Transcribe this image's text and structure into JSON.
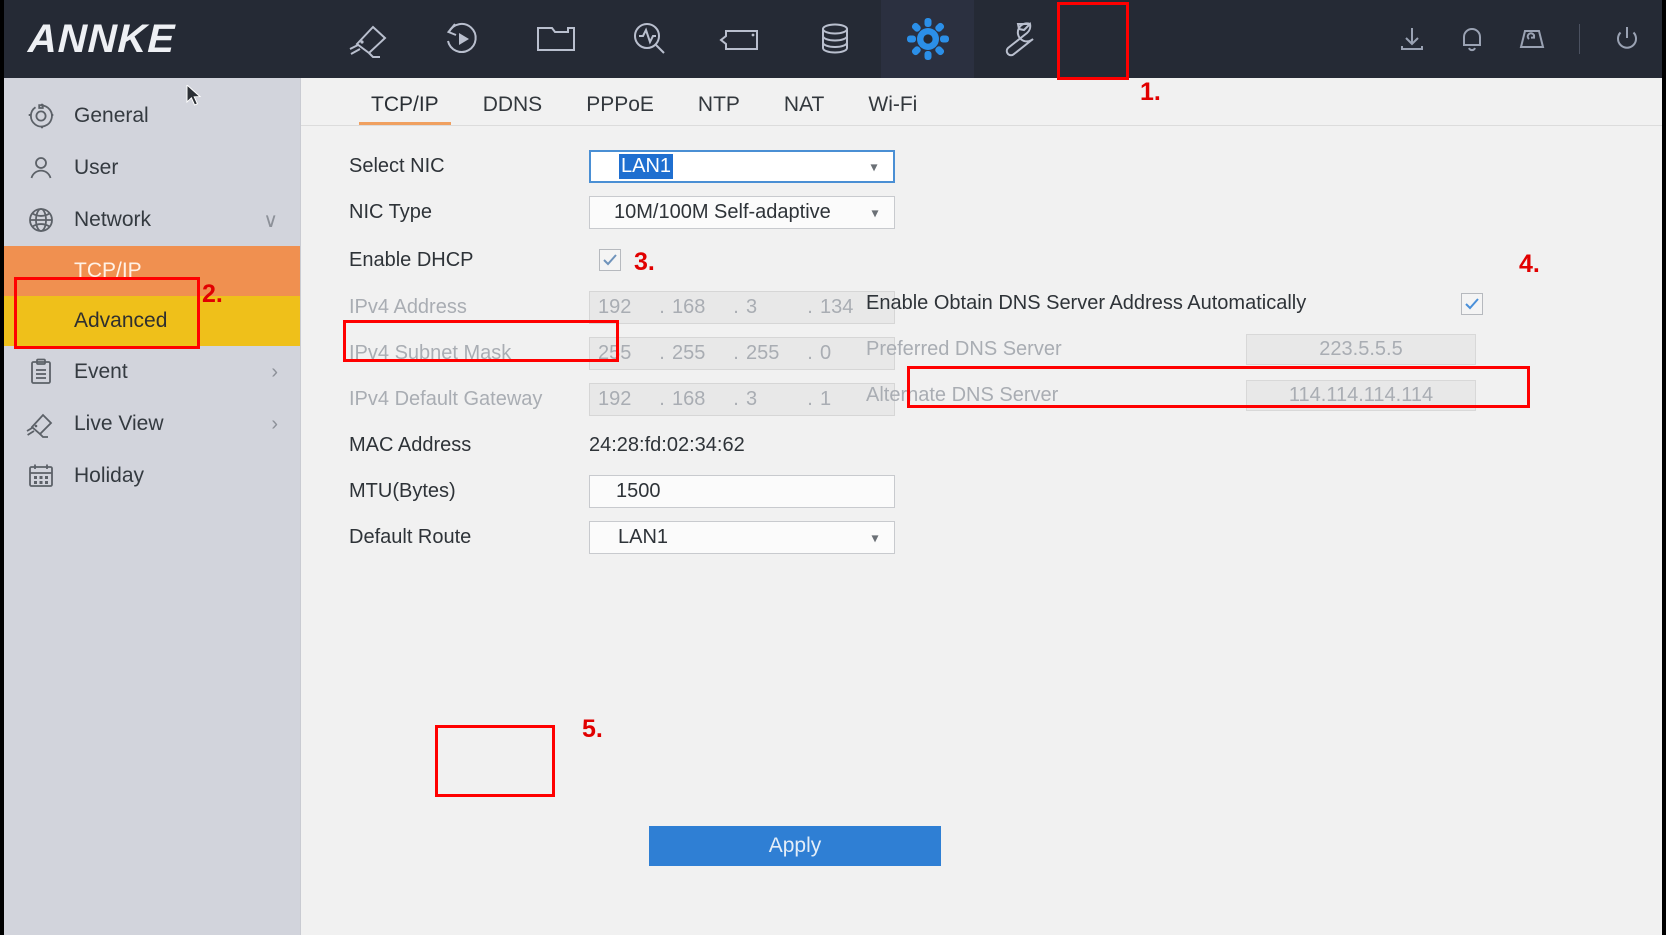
{
  "brand": {
    "name": "ANNKE"
  },
  "topbar": {
    "nav_icons": [
      {
        "name": "camera-icon",
        "label": "Camera"
      },
      {
        "name": "playback-icon",
        "label": "Playback"
      },
      {
        "name": "folder-icon",
        "label": "File Management"
      },
      {
        "name": "smart-search-icon",
        "label": "Smart Analysis"
      },
      {
        "name": "record-icon",
        "label": "Record"
      },
      {
        "name": "storage-icon",
        "label": "Storage"
      },
      {
        "name": "gear-icon",
        "label": "System Configuration"
      },
      {
        "name": "wrench-icon",
        "label": "Maintenance"
      }
    ],
    "active_icon": "gear-icon",
    "right_icons": [
      {
        "name": "download-icon",
        "label": "Download"
      },
      {
        "name": "bell-icon",
        "label": "Alarm"
      },
      {
        "name": "device-icon",
        "label": "Device"
      },
      {
        "name": "power-icon",
        "label": "Power"
      }
    ]
  },
  "sidebar": {
    "items": [
      {
        "label": "General",
        "icon": "gear-outline-icon",
        "expandable": false,
        "chevron": ""
      },
      {
        "label": "User",
        "icon": "user-icon",
        "expandable": false,
        "chevron": ""
      },
      {
        "label": "Network",
        "icon": "globe-icon",
        "expandable": true,
        "chevron": "∨"
      },
      {
        "label": "Event",
        "icon": "clipboard-icon",
        "expandable": true,
        "chevron": "›"
      },
      {
        "label": "Live View",
        "icon": "camera-icon",
        "expandable": true,
        "chevron": "›"
      },
      {
        "label": "Holiday",
        "icon": "calendar-icon",
        "expandable": false,
        "chevron": ""
      }
    ],
    "network_children": [
      {
        "label": "TCP/IP",
        "state": "selected"
      },
      {
        "label": "Advanced",
        "state": "hover"
      }
    ]
  },
  "tabs": {
    "items": [
      "TCP/IP",
      "DDNS",
      "PPPoE",
      "NTP",
      "NAT",
      "Wi-Fi"
    ],
    "active": "TCP/IP"
  },
  "form": {
    "select_nic": {
      "label": "Select NIC",
      "value": "LAN1",
      "selected_text": true
    },
    "nic_type": {
      "label": "NIC Type",
      "value": "10M/100M Self-adaptive"
    },
    "enable_dhcp": {
      "label": "Enable DHCP",
      "checked": true
    },
    "ipv4_address": {
      "label": "IPv4 Address",
      "octets": [
        "192",
        "168",
        "3",
        "134"
      ],
      "disabled": true
    },
    "ipv4_subnet_mask": {
      "label": "IPv4 Subnet Mask",
      "octets": [
        "255",
        "255",
        "255",
        "0"
      ],
      "disabled": true
    },
    "ipv4_default_gateway": {
      "label": "IPv4 Default Gateway",
      "octets": [
        "192",
        "168",
        "3",
        "1"
      ],
      "disabled": true
    },
    "mac_address": {
      "label": "MAC Address",
      "value": "24:28:fd:02:34:62"
    },
    "mtu": {
      "label": "MTU(Bytes)",
      "value": "1500"
    },
    "default_route": {
      "label": "Default Route",
      "value": "LAN1"
    },
    "dns_auto": {
      "label": "Enable Obtain DNS Server Address Automatically",
      "checked": true
    },
    "preferred_dns": {
      "label": "Preferred DNS Server",
      "value": "223.5.5.5",
      "disabled": true
    },
    "alternate_dns": {
      "label": "Alternate DNS Server",
      "value": "114.114.114.114",
      "disabled": true
    },
    "apply_button": {
      "label": "Apply"
    }
  },
  "annotations": {
    "color": "#ff0000",
    "steps": [
      {
        "number": "1.",
        "target": "gear-icon"
      },
      {
        "number": "2.",
        "target": "network-tcpip-sidebar"
      },
      {
        "number": "3.",
        "target": "enable-dhcp-row"
      },
      {
        "number": "4.",
        "target": "dns-auto-row"
      },
      {
        "number": "5.",
        "target": "apply-button"
      }
    ]
  }
}
